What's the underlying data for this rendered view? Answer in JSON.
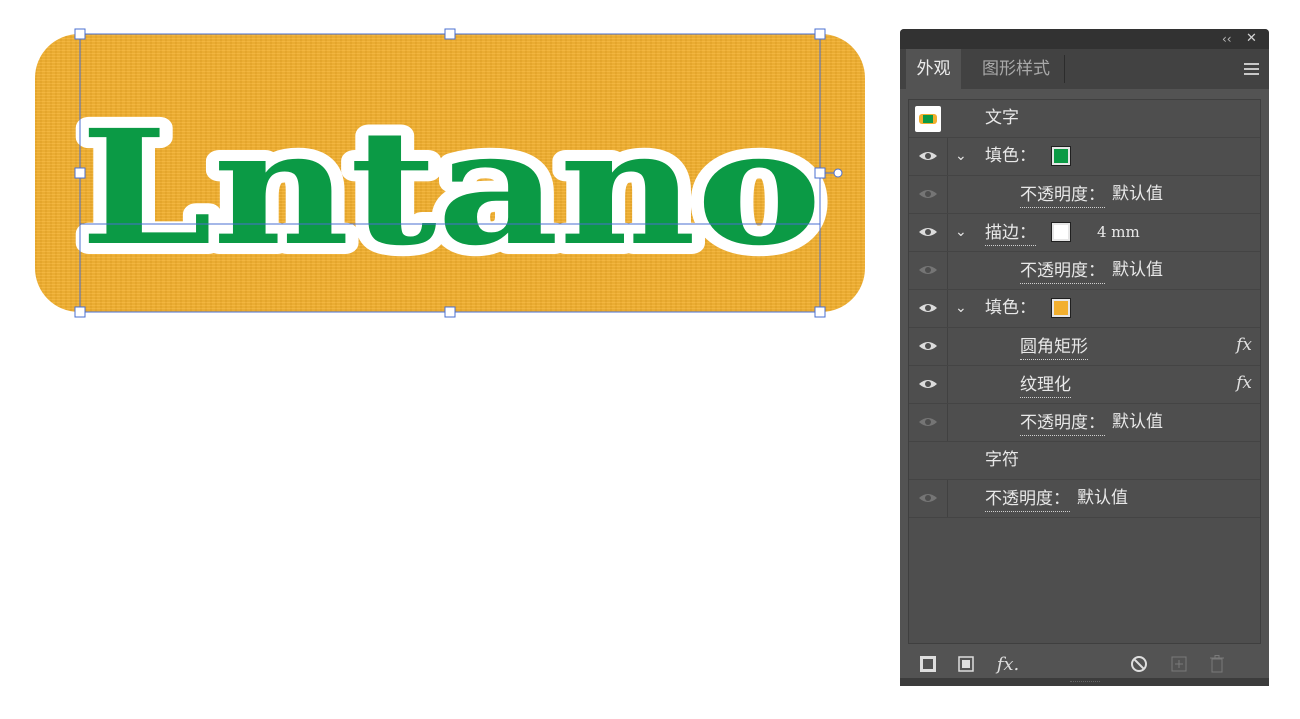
{
  "artwork": {
    "text": "Lntano",
    "fill_color": "#0B9A45",
    "stroke_color": "#FFFFFF",
    "background_color": "#F2AF2E",
    "selection_color": "#4A6FD0"
  },
  "panel": {
    "collapse_glyph": "‹‹",
    "close_glyph": "✕",
    "tabs": [
      {
        "label": "外观",
        "active": true
      },
      {
        "label": "图形样式",
        "active": false
      }
    ],
    "menu_icon": "hamburger-icon",
    "rows": {
      "header": {
        "label": "文字",
        "thumb_icon": "text-thumbnail-icon"
      },
      "fill1": {
        "label": "填色：",
        "swatch": "#0B9A45"
      },
      "fill1_opacity": {
        "label": "不透明度：",
        "value": "默认值"
      },
      "stroke": {
        "label": "描边：",
        "swatch": "#FFFFFF",
        "value": "4 mm"
      },
      "stroke_opacity": {
        "label": "不透明度：",
        "value": "默认值"
      },
      "fill2": {
        "label": "填色：",
        "swatch": "#F2AF2E"
      },
      "effect1": {
        "label": "圆角矩形",
        "fx": "fx"
      },
      "effect2": {
        "label": "纹理化",
        "fx": "fx"
      },
      "fill2_opacity": {
        "label": "不透明度：",
        "value": "默认值"
      },
      "characters": {
        "label": "字符"
      },
      "char_opacity": {
        "label": "不透明度：",
        "value": "默认值"
      }
    },
    "bottom_icons": [
      "add-stroke-icon",
      "add-fill-icon",
      "add-effect-icon",
      "clear-appearance-icon",
      "duplicate-item-icon",
      "delete-item-icon"
    ]
  }
}
